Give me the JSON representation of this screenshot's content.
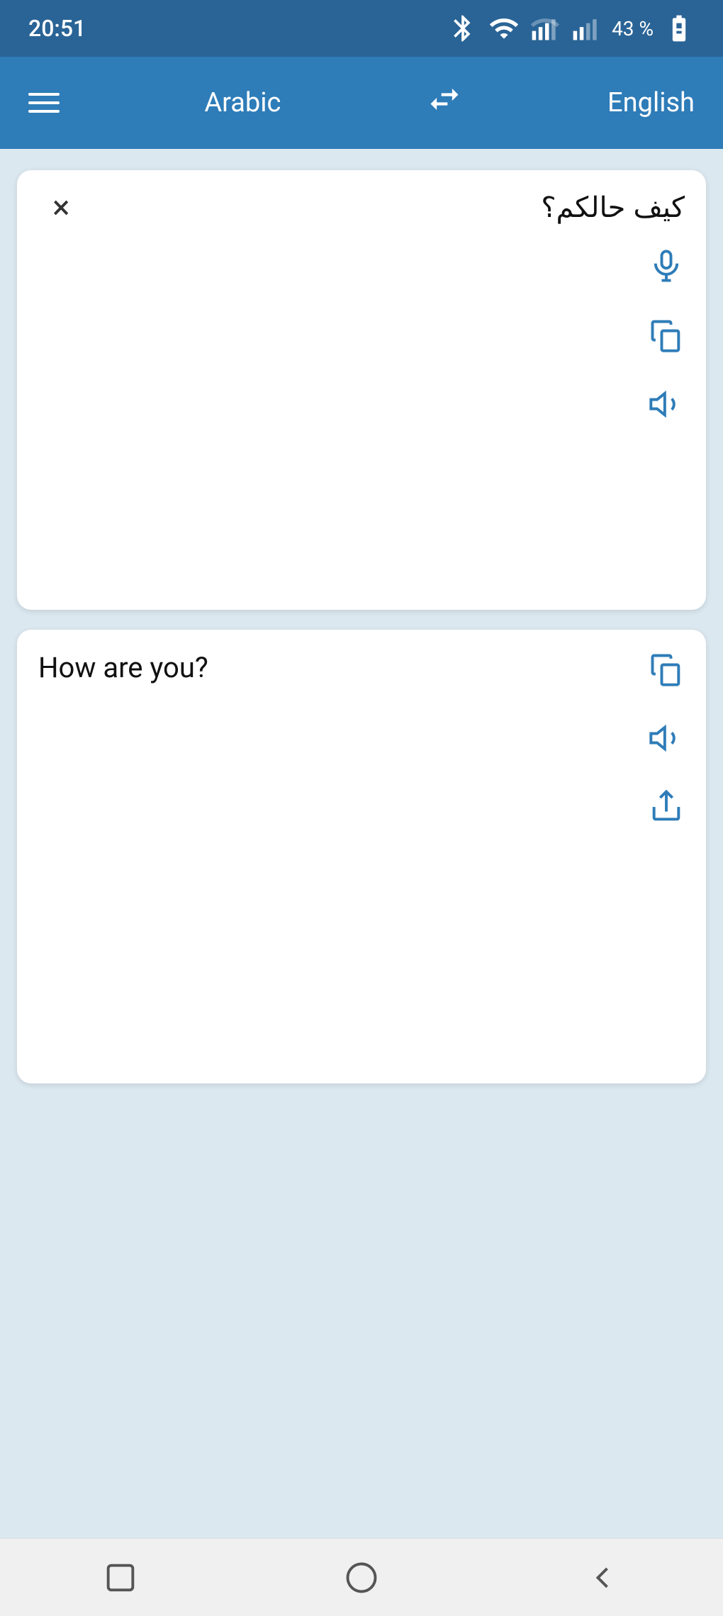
{
  "statusBar": {
    "time": "20:51",
    "batteryPercent": "43 %"
  },
  "appBar": {
    "menuLabel": "menu",
    "sourceLanguage": "Arabic",
    "swapLabel": "swap",
    "targetLanguage": "English"
  },
  "inputCard": {
    "inputText": "كيف حالكم؟",
    "clearLabel": "×",
    "micLabel": "microphone",
    "copyLabel": "copy",
    "speakLabel": "speak"
  },
  "outputCard": {
    "translatedText": "How are you?",
    "copyLabel": "copy",
    "speakLabel": "speak",
    "shareLabel": "share"
  },
  "bottomNav": {
    "squareLabel": "recent-apps",
    "circleLabel": "home",
    "backLabel": "back"
  }
}
